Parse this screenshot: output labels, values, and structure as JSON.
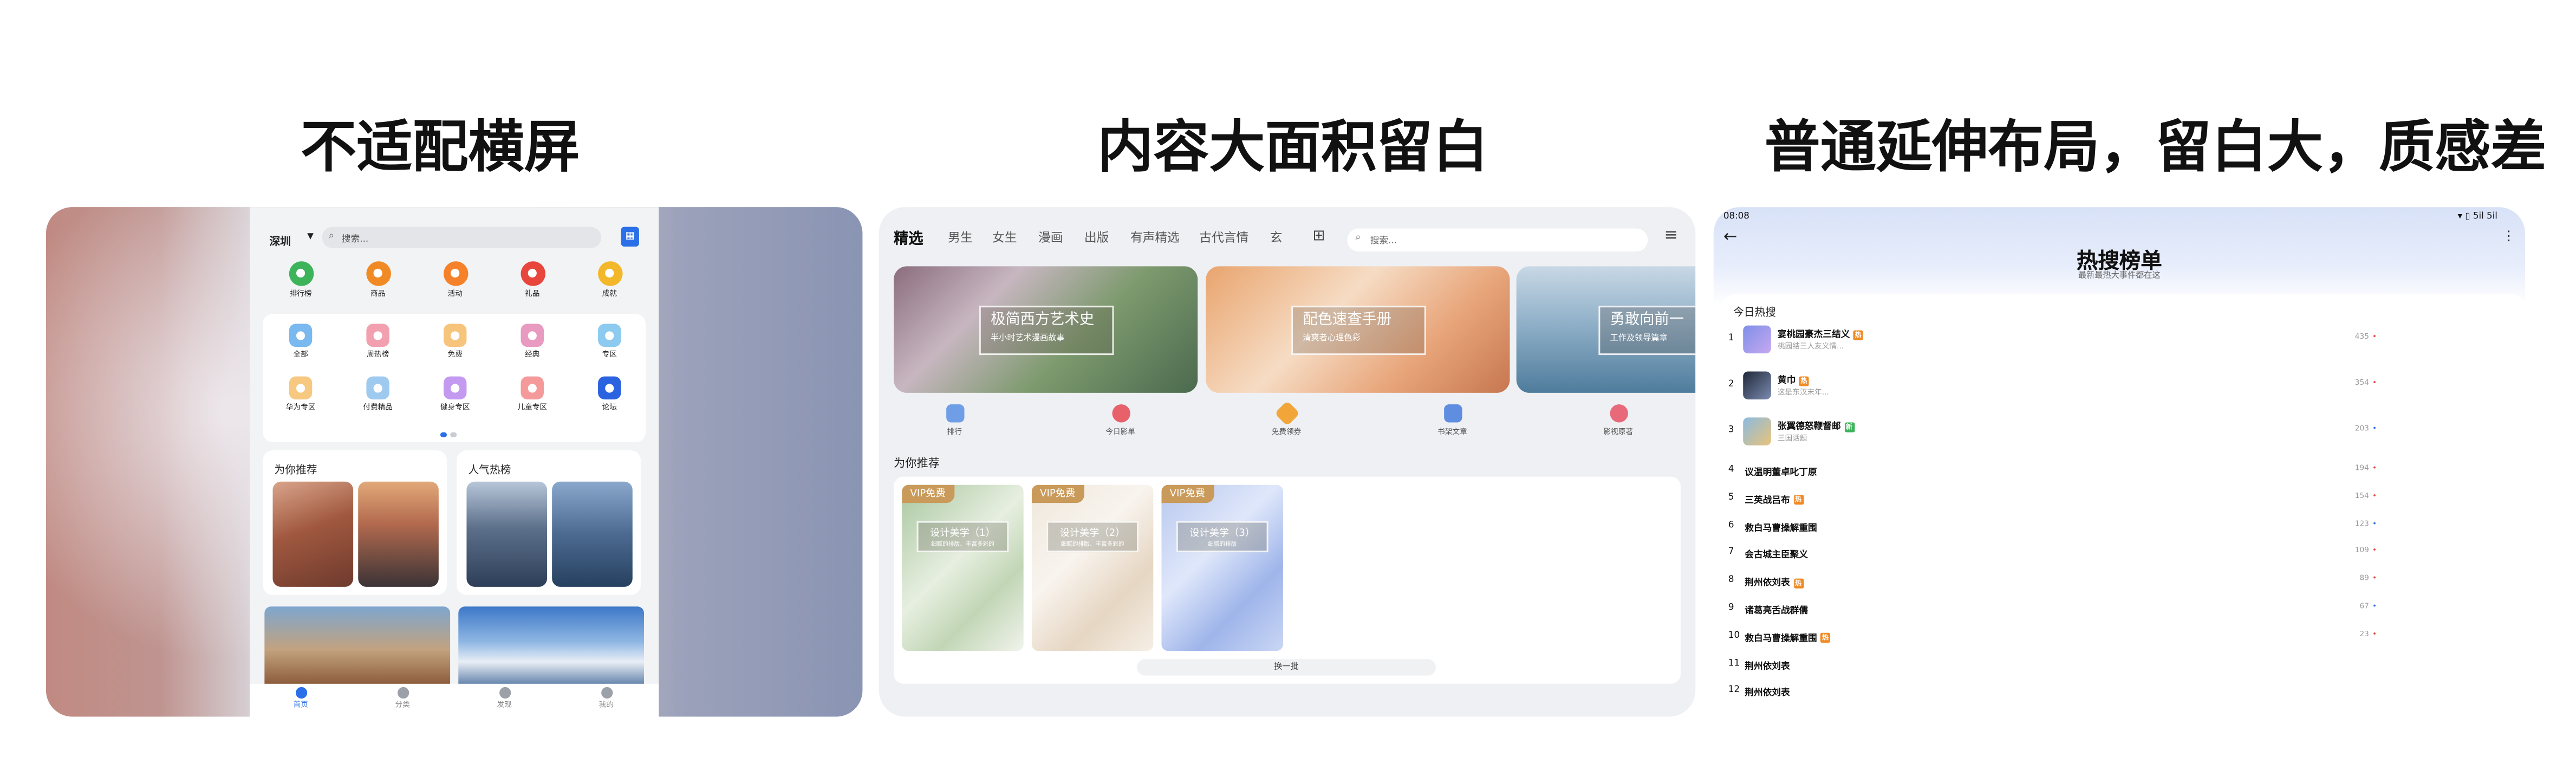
{
  "titles": [
    "不适配横屏",
    "内容大面积留白",
    "普通延伸布局，留白大，质感差"
  ],
  "panel1": {
    "city": "深圳",
    "search_placeholder": "搜索...",
    "row1": [
      {
        "label": "排行榜",
        "icon": "chart-icon",
        "color": "#3db35a"
      },
      {
        "label": "商品",
        "icon": "tag-icon",
        "color": "#f08a24"
      },
      {
        "label": "活动",
        "icon": "flag-icon",
        "color": "#f5822a"
      },
      {
        "label": "礼品",
        "icon": "gift-icon",
        "color": "#e8453c"
      },
      {
        "label": "成就",
        "icon": "medal-icon",
        "color": "#f3b82a"
      }
    ],
    "row2": [
      {
        "label": "全部",
        "icon": "grid-icon",
        "color": "#7ab8f0"
      },
      {
        "label": "周热榜",
        "icon": "calendar-icon",
        "color": "#f2a0b0"
      },
      {
        "label": "免费",
        "icon": "coupon-icon",
        "color": "#f7c47c"
      },
      {
        "label": "经典",
        "icon": "book-icon",
        "color": "#e89ac0"
      },
      {
        "label": "专区",
        "icon": "play-icon",
        "color": "#8ccaf0"
      }
    ],
    "row3": [
      {
        "label": "华为专区",
        "icon": "store-icon",
        "color": "#f7c880"
      },
      {
        "label": "付费精品",
        "icon": "diamond-icon",
        "color": "#9ecaf0"
      },
      {
        "label": "健身专区",
        "icon": "fitness-icon",
        "color": "#c39af0"
      },
      {
        "label": "儿童专区",
        "icon": "child-icon",
        "color": "#f59a9a"
      },
      {
        "label": "论坛",
        "icon": "chat-icon",
        "color": "#2a62e0"
      }
    ],
    "recommend_title": "为你推荐",
    "popular_title": "人气热榜",
    "tabs": [
      "首页",
      "分类",
      "发现",
      "我的"
    ]
  },
  "panel2": {
    "tabs": [
      "精选",
      "男生",
      "女生",
      "漫画",
      "出版",
      "有声精选",
      "古代言情",
      "玄"
    ],
    "search_placeholder": "搜索...",
    "banners": [
      {
        "title": "极简西方艺术史",
        "subtitle": "半小时艺术漫画故事"
      },
      {
        "title": "配色速查手册",
        "subtitle": "清爽者心理色彩"
      },
      {
        "title": "勇敢向前一",
        "subtitle": "工作及领导篇章"
      }
    ],
    "quick": [
      "排行",
      "今日影单",
      "免费领券",
      "书架文章",
      "影视原著"
    ],
    "recommend_title": "为你推荐",
    "vip_items": [
      {
        "tag": "VIP免费",
        "title": "设计美学（1）",
        "subtitle": "细腻的排版、丰富多彩的"
      },
      {
        "tag": "VIP免费",
        "title": "设计美学（2）",
        "subtitle": "细腻的排版、丰富多彩的"
      },
      {
        "tag": "VIP免费",
        "title": "设计美学（3）",
        "subtitle": "细腻的排版"
      }
    ],
    "more_label": "换一批"
  },
  "panel3": {
    "time": "08:08",
    "status_right": "▾ ▯ 5il 5il",
    "title": "热搜榜单",
    "subtitle": "最新最热大事件都在这",
    "section": "今日热搜",
    "rows": [
      {
        "rank": "1",
        "name": "宴桃园豪杰三结义",
        "sub": "桃园结三人友义情...",
        "count": "435",
        "badge": "热",
        "badge_color": "#f08a24"
      },
      {
        "rank": "2",
        "name": "黄巾",
        "sub": "这是东汉末年...",
        "count": "354",
        "badge": "热",
        "badge_color": "#f08a24"
      },
      {
        "rank": "3",
        "name": "张翼德怒鞭督邮",
        "sub": "三国话题",
        "count": "203",
        "badge": "新",
        "badge_color": "#3db35a"
      },
      {
        "rank": "4",
        "name": "议温明董卓叱丁原",
        "count": "194",
        "badge": "",
        "badge_color": ""
      },
      {
        "rank": "5",
        "name": "三英战吕布",
        "count": "154",
        "badge": "热",
        "badge_color": "#f08a24"
      },
      {
        "rank": "6",
        "name": "救白马曹操解重围",
        "count": "123",
        "badge": "",
        "badge_color": ""
      },
      {
        "rank": "7",
        "name": "会古城主臣聚义",
        "count": "109",
        "badge": "",
        "badge_color": ""
      },
      {
        "rank": "8",
        "name": "荆州依刘表",
        "count": "89",
        "badge": "热",
        "badge_color": "#f08a24"
      },
      {
        "rank": "9",
        "name": "诸葛亮舌战群儒",
        "count": "67",
        "badge": "",
        "badge_color": ""
      },
      {
        "rank": "10",
        "name": "救白马曹操解重围",
        "count": "23",
        "badge": "热",
        "badge_color": "#f08a24"
      },
      {
        "rank": "11",
        "name": "荆州依刘表",
        "count": "",
        "badge": "",
        "badge_color": ""
      },
      {
        "rank": "12",
        "name": "荆州依刘表",
        "count": "",
        "badge": "",
        "badge_color": ""
      }
    ]
  }
}
